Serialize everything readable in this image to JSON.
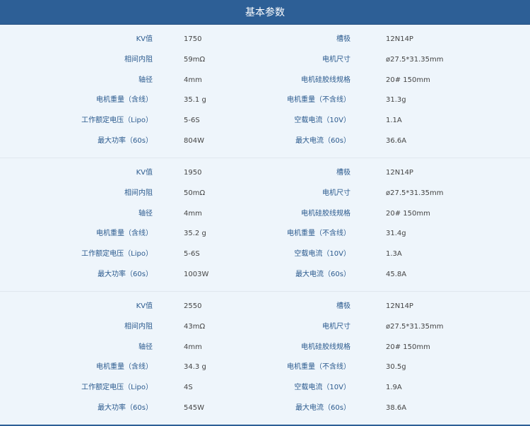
{
  "header": {
    "title": "基本参数"
  },
  "sections": [
    {
      "rows": [
        {
          "label1": "KV值",
          "value1": "1750",
          "label2": "槽极",
          "value2": "12N14P"
        },
        {
          "label1": "相间内阻",
          "value1": "59mΩ",
          "label2": "电机尺寸",
          "value2": "ø27.5*31.35mm"
        },
        {
          "label1": "轴径",
          "value1": "4mm",
          "label2": "电机硅胶线规格",
          "value2": "20# 150mm"
        },
        {
          "label1": "电机重量（含线）",
          "value1": "35.1 g",
          "label2": "电机重量（不含线）",
          "value2": "31.3g"
        },
        {
          "label1": "工作额定电压（Lipo）",
          "value1": "5-6S",
          "label2": "空载电流（10V）",
          "value2": "1.1A"
        },
        {
          "label1": "最大功率（60s）",
          "value1": "804W",
          "label2": "最大电流（60s）",
          "value2": "36.6A"
        }
      ]
    },
    {
      "rows": [
        {
          "label1": "KV值",
          "value1": "1950",
          "label2": "槽极",
          "value2": "12N14P"
        },
        {
          "label1": "相间内阻",
          "value1": "50mΩ",
          "label2": "电机尺寸",
          "value2": "ø27.5*31.35mm"
        },
        {
          "label1": "轴径",
          "value1": "4mm",
          "label2": "电机硅胶线规格",
          "value2": "20# 150mm"
        },
        {
          "label1": "电机重量（含线）",
          "value1": "35.2 g",
          "label2": "电机重量（不含线）",
          "value2": "31.4g"
        },
        {
          "label1": "工作额定电压（Lipo）",
          "value1": "5-6S",
          "label2": "空载电流（10V）",
          "value2": "1.3A"
        },
        {
          "label1": "最大功率（60s）",
          "value1": "1003W",
          "label2": "最大电流（60s）",
          "value2": "45.8A"
        }
      ]
    },
    {
      "rows": [
        {
          "label1": "KV值",
          "value1": "2550",
          "label2": "槽极",
          "value2": "12N14P"
        },
        {
          "label1": "相间内阻",
          "value1": "43mΩ",
          "label2": "电机尺寸",
          "value2": "ø27.5*31.35mm"
        },
        {
          "label1": "轴径",
          "value1": "4mm",
          "label2": "电机硅胶线规格",
          "value2": "20# 150mm"
        },
        {
          "label1": "电机重量（含线）",
          "value1": "34.3 g",
          "label2": "电机重量（不含线）",
          "value2": "30.5g"
        },
        {
          "label1": "工作额定电压（Lipo）",
          "value1": "4S",
          "label2": "空载电流（10V）",
          "value2": "1.9A"
        },
        {
          "label1": "最大功率（60s）",
          "value1": "545W",
          "label2": "最大电流（60s）",
          "value2": "38.6A"
        }
      ]
    }
  ]
}
